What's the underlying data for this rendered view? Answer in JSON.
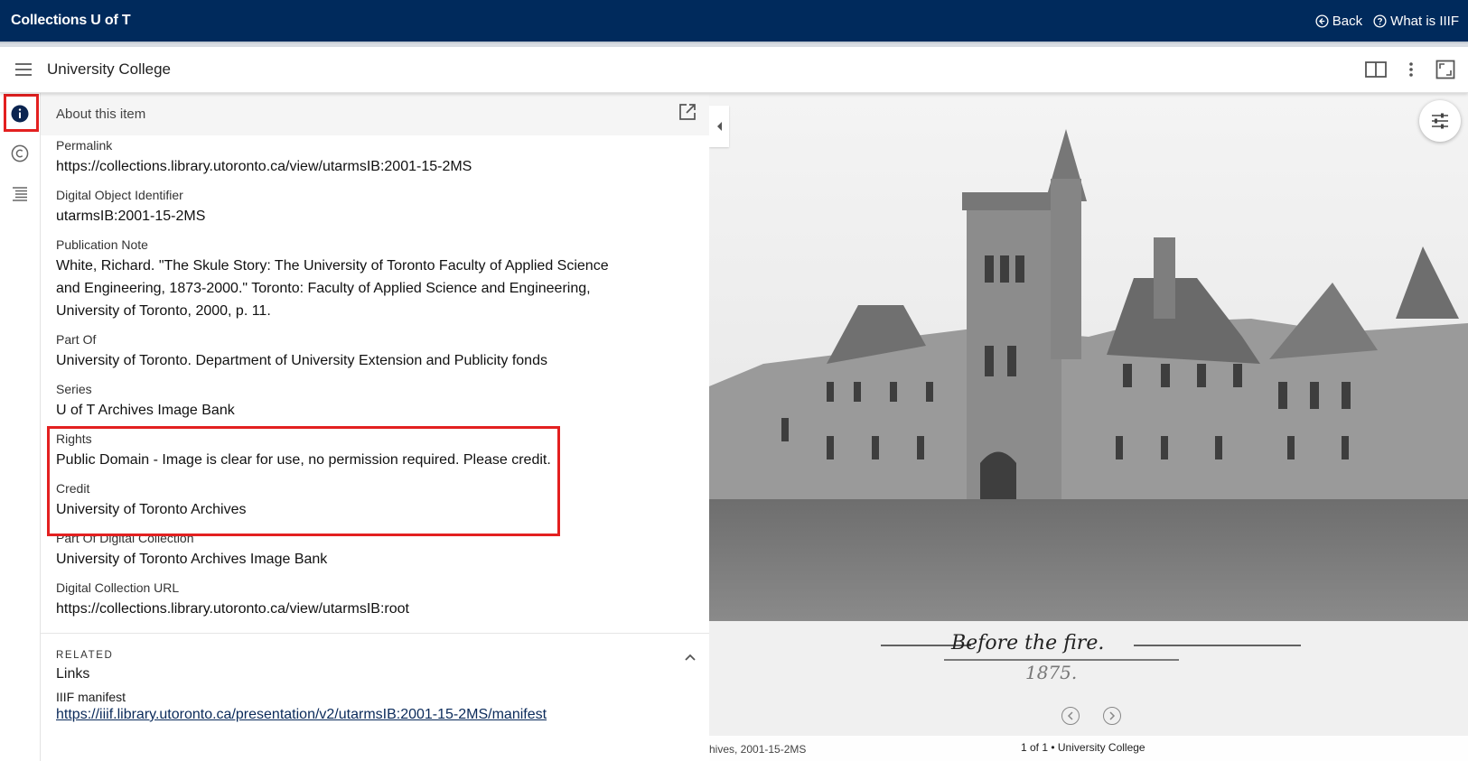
{
  "header": {
    "brand": "Collections U of T",
    "back_label": "Back",
    "iiif_label": "What is IIIF"
  },
  "subbar": {
    "title": "University College"
  },
  "panel": {
    "title": "About this item",
    "fields": [
      {
        "label": "Permalink",
        "value": "https://collections.library.utoronto.ca/view/utarmsIB:2001-15-2MS"
      },
      {
        "label": "Digital Object Identifier",
        "value": "utarmsIB:2001-15-2MS"
      },
      {
        "label": "Publication Note",
        "value": "White, Richard. \"The Skule Story: The University of Toronto Faculty of Applied Science and Engineering, 1873-2000.\" Toronto: Faculty of Applied Science and Engineering, University of Toronto, 2000, p. 11."
      },
      {
        "label": "Part Of",
        "value": "University of Toronto. Department of University Extension and Publicity fonds"
      },
      {
        "label": "Series",
        "value": "U of T Archives Image Bank"
      },
      {
        "label": "Rights",
        "value": "Public Domain - Image is clear for use, no permission required. Please credit."
      },
      {
        "label": "Credit",
        "value": "University of Toronto Archives"
      },
      {
        "label": "Part Of Digital Collection",
        "value": "University of Toronto Archives Image Bank"
      },
      {
        "label": "Digital Collection URL",
        "value": "https://collections.library.utoronto.ca/view/utarmsIB:root"
      }
    ],
    "related": {
      "heading": "RELATED",
      "links_label": "Links",
      "manifest_label": "IIIF manifest",
      "manifest_url": "https://iiif.library.utoronto.ca/presentation/v2/utarmsIB:2001-15-2MS/manifest"
    }
  },
  "viewer": {
    "caption_line1": "Before the fire.",
    "caption_line2": "1875.",
    "footer_left": "hives, 2001-15-2MS",
    "footer_center": "1 of 1 • University College"
  },
  "colors": {
    "topbar": "#002a5c",
    "highlight": "#e32020",
    "link": "#0a2a5a"
  },
  "icons": [
    "back-icon",
    "help-icon",
    "menu-icon",
    "book-view-icon",
    "more-vert-icon",
    "fullscreen-icon",
    "info-icon",
    "copyright-icon",
    "toc-icon",
    "open-new-window-icon",
    "chevron-up-icon",
    "collapse-left-icon",
    "tune-icon",
    "previous-icon",
    "next-icon"
  ]
}
